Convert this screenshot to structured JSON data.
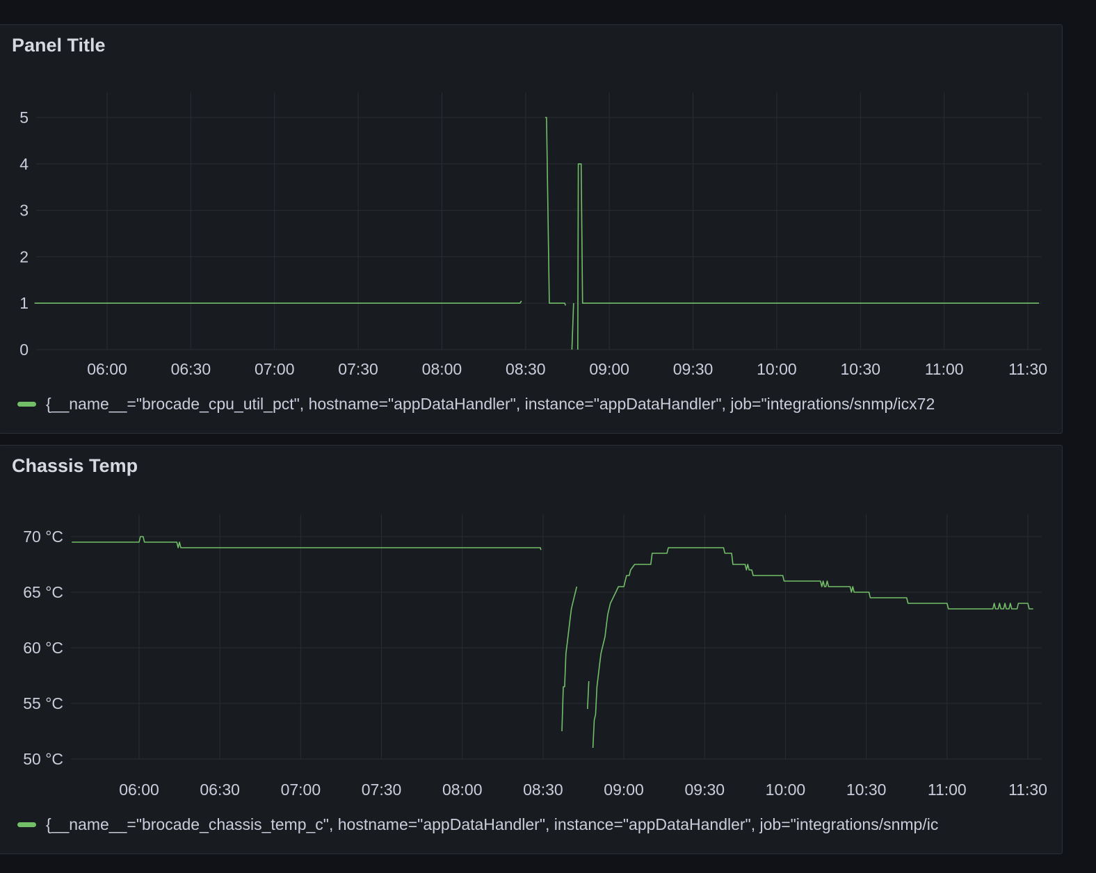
{
  "colors": {
    "series": "#73bf69",
    "grid": "#2a2d33",
    "panel_bg": "#181b1f"
  },
  "chart_data": [
    {
      "type": "line",
      "title": "Panel Title",
      "unit": "",
      "ylim": [
        0,
        5
      ],
      "yticks": [
        "0",
        "1",
        "2",
        "3",
        "4",
        "5"
      ],
      "xticks": [
        "06:00",
        "06:30",
        "07:00",
        "07:30",
        "08:00",
        "08:30",
        "09:00",
        "09:30",
        "10:00",
        "10:30",
        "11:00",
        "11:30"
      ],
      "legend_placement": "bottom",
      "grid": true,
      "series": [
        {
          "name": "{__name__=\"brocade_cpu_util_pct\", hostname=\"appDataHandler\", instance=\"appDataHandler\", job=\"integrations/snmp/icx72",
          "segments": [
            [
              [
                "05:34",
                1
              ],
              [
                "08:28",
                1
              ],
              [
                "08:28.5",
                1.05
              ]
            ],
            [
              [
                "08:37",
                5
              ],
              [
                "08:37.5",
                5
              ],
              [
                "08:38.5",
                1
              ],
              [
                "08:44",
                1
              ],
              [
                "08:44.3",
                0.95
              ]
            ],
            [
              [
                "08:46.6",
                0
              ],
              [
                "08:47.2",
                1
              ]
            ],
            [
              [
                "08:48.7",
                0
              ],
              [
                "08:48.9",
                4
              ],
              [
                "08:49.9",
                4
              ],
              [
                "08:50.4",
                1
              ],
              [
                "11:34",
                1
              ]
            ]
          ]
        }
      ]
    },
    {
      "type": "line",
      "title": "Chassis Temp",
      "unit": "°C",
      "ylim": [
        50,
        72
      ],
      "yticks": [
        "50 °C",
        "55 °C",
        "60 °C",
        "65 °C",
        "70 °C"
      ],
      "xticks": [
        "06:00",
        "06:30",
        "07:00",
        "07:30",
        "08:00",
        "08:30",
        "09:00",
        "09:30",
        "10:00",
        "10:30",
        "11:00",
        "11:30"
      ],
      "legend_placement": "bottom",
      "grid": true,
      "series": [
        {
          "name": "{__name__=\"brocade_chassis_temp_c\", hostname=\"appDataHandler\", instance=\"appDataHandler\", job=\"integrations/snmp/ic",
          "segments": [
            [
              [
                "05:35",
                69.5
              ],
              [
                "06:00",
                69.5
              ],
              [
                "06:00.5",
                70
              ],
              [
                "06:01.5",
                70
              ],
              [
                "06:02",
                69.5
              ],
              [
                "06:14",
                69.5
              ],
              [
                "06:14.5",
                69
              ],
              [
                "06:15",
                69.5
              ],
              [
                "06:15.5",
                69
              ],
              [
                "06:16",
                69
              ],
              [
                "08:29",
                69
              ],
              [
                "08:29.2",
                68.8
              ]
            ],
            [
              [
                "08:37",
                52.5
              ],
              [
                "08:37.5",
                56.5
              ],
              [
                "08:38",
                56.5
              ],
              [
                "08:38.5",
                59.5
              ],
              [
                "08:39",
                60.5
              ],
              [
                "08:39.5",
                61.5
              ],
              [
                "08:40",
                62.5
              ],
              [
                "08:40.5",
                63.5
              ],
              [
                "08:41",
                64
              ],
              [
                "08:41.5",
                64.5
              ],
              [
                "08:42",
                65
              ],
              [
                "08:42.5",
                65.5
              ]
            ],
            [
              [
                "08:46.5",
                54.5
              ],
              [
                "08:47",
                57
              ]
            ],
            [
              [
                "08:48.5",
                51
              ],
              [
                "08:49",
                53.5
              ],
              [
                "08:49.5",
                54
              ],
              [
                "08:50",
                56.5
              ],
              [
                "08:51",
                58.5
              ],
              [
                "08:51.5",
                59.5
              ],
              [
                "08:52",
                60
              ],
              [
                "08:53",
                61
              ],
              [
                "08:53.5",
                62
              ],
              [
                "08:54",
                63
              ],
              [
                "08:55",
                64
              ],
              [
                "08:56",
                64.5
              ],
              [
                "08:57",
                65
              ],
              [
                "08:58",
                65.5
              ],
              [
                "09:00",
                65.5
              ],
              [
                "09:00.5",
                66
              ],
              [
                "09:01",
                66.5
              ],
              [
                "09:02",
                66.5
              ],
              [
                "09:02.5",
                67
              ],
              [
                "09:04",
                67.5
              ],
              [
                "09:10",
                67.5
              ],
              [
                "09:10.5",
                68.5
              ],
              [
                "09:16",
                68.5
              ],
              [
                "09:16.5",
                69
              ],
              [
                "09:37",
                69
              ],
              [
                "09:37.5",
                68.5
              ],
              [
                "09:40",
                68.5
              ],
              [
                "09:40.5",
                67.5
              ],
              [
                "09:45",
                67.5
              ],
              [
                "09:45.5",
                67
              ],
              [
                "09:46",
                67.5
              ],
              [
                "09:46.5",
                67
              ],
              [
                "09:47.5",
                67
              ],
              [
                "09:48",
                66.5
              ],
              [
                "09:59",
                66.5
              ],
              [
                "09:59.5",
                66
              ],
              [
                "10:13",
                66
              ],
              [
                "10:13.5",
                65.5
              ],
              [
                "10:14",
                66
              ],
              [
                "10:14.5",
                65.5
              ],
              [
                "10:15",
                65.5
              ],
              [
                "10:15.5",
                66
              ],
              [
                "10:16",
                65.5
              ],
              [
                "10:24",
                65.5
              ],
              [
                "10:24.5",
                65
              ],
              [
                "10:25",
                65.5
              ],
              [
                "10:25.5",
                65
              ],
              [
                "10:31",
                65
              ],
              [
                "10:31.5",
                64.5
              ],
              [
                "10:45",
                64.5
              ],
              [
                "10:45.5",
                64
              ],
              [
                "11:00",
                64
              ],
              [
                "11:00.5",
                63.5
              ],
              [
                "11:17",
                63.5
              ],
              [
                "11:17.5",
                64
              ],
              [
                "11:18",
                63.5
              ],
              [
                "11:19",
                63.5
              ],
              [
                "11:19.5",
                64
              ],
              [
                "11:20",
                63.5
              ],
              [
                "11:21",
                63.5
              ],
              [
                "11:21.5",
                64
              ],
              [
                "11:22",
                63.5
              ],
              [
                "11:23",
                63.5
              ],
              [
                "11:23.5",
                64
              ],
              [
                "11:24",
                63.5
              ],
              [
                "11:26",
                63.5
              ],
              [
                "11:26.5",
                64
              ],
              [
                "11:30",
                64
              ],
              [
                "11:30.5",
                63.5
              ],
              [
                "11:32",
                63.5
              ]
            ]
          ]
        }
      ]
    }
  ]
}
